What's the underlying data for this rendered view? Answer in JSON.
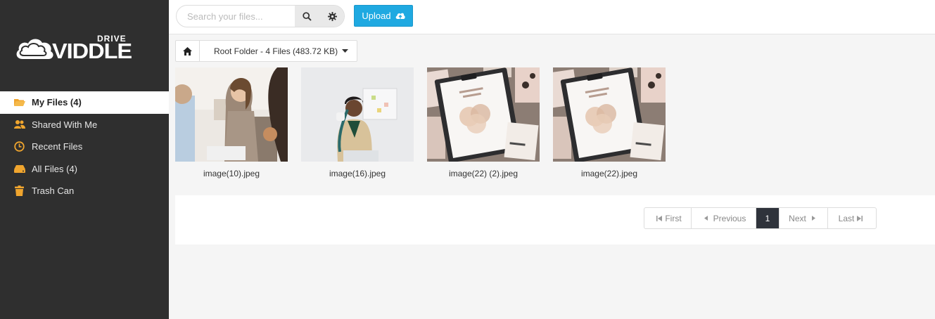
{
  "brand": {
    "logo_small": "DRIVE",
    "logo_main": "VIDDLE"
  },
  "sidebar": {
    "items": [
      {
        "label": "My Files (4)",
        "icon": "folder-open-icon",
        "color": "#f0a52e",
        "active": true
      },
      {
        "label": "Shared With Me",
        "icon": "users-icon",
        "color": "#f0a52e"
      },
      {
        "label": "Recent Files",
        "icon": "clock-icon",
        "color": "#f0a52e"
      },
      {
        "label": "All Files (4)",
        "icon": "drive-icon",
        "color": "#f0a52e"
      },
      {
        "label": "Trash Can",
        "icon": "trash-icon",
        "color": "#f0a52e"
      }
    ]
  },
  "header": {
    "search_placeholder": "Search your files...",
    "upload_label": "Upload"
  },
  "breadcrumb": {
    "folder_label": "Root Folder - 4 Files (483.72 KB)"
  },
  "files": [
    {
      "name": "image(10).jpeg"
    },
    {
      "name": "image(16).jpeg"
    },
    {
      "name": "image(22) (2).jpeg"
    },
    {
      "name": "image(22).jpeg"
    }
  ],
  "pagination": {
    "first": "First",
    "previous": "Previous",
    "current": "1",
    "next": "Next",
    "last": "Last"
  },
  "colors": {
    "sidebar_bg": "#2f2f2f",
    "accent": "#1fa9e1",
    "icon_orange": "#f0a52e",
    "pager_active": "#2f333b"
  }
}
